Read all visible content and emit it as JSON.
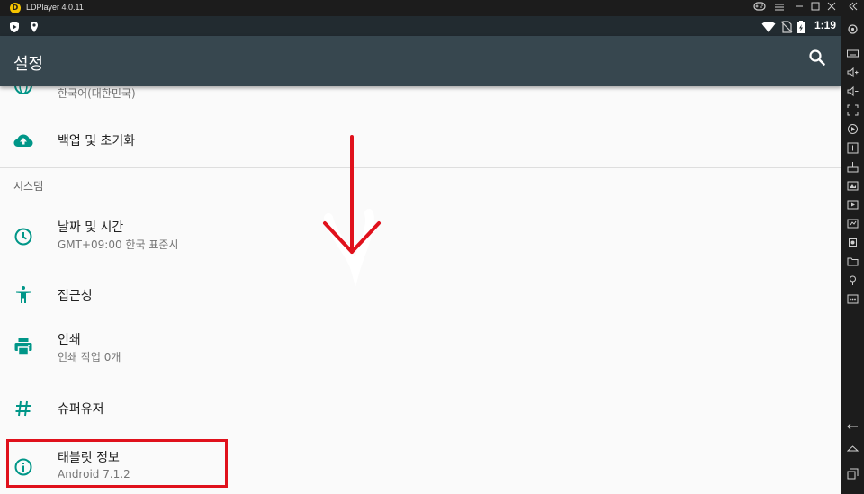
{
  "emulator": {
    "title": "LDPlayer 4.0.11",
    "logo_glyph": "D",
    "controls": [
      "gamepad-icon",
      "menu-icon",
      "minimize-icon",
      "maximize-icon",
      "close-icon",
      "collapse-icon"
    ]
  },
  "statusbar": {
    "time": "1:19",
    "left_icons": [
      "shield-play-icon",
      "location-pin-icon"
    ],
    "right_icons": [
      "wifi-icon",
      "no-sim-icon",
      "battery-charging-icon"
    ]
  },
  "appbar": {
    "title": "설정",
    "action_icon": "search-icon"
  },
  "settings": {
    "partial_row": {
      "subtitle": "한국어(대한민국)",
      "icon": "globe-icon"
    },
    "backup_row": {
      "title": "백업 및 초기화",
      "icon": "cloud-upload-icon"
    },
    "section_system": "시스템",
    "datetime_row": {
      "title": "날짜 및 시간",
      "subtitle": "GMT+09:00 한국 표준시",
      "icon": "clock-icon"
    },
    "accessibility_row": {
      "title": "접근성",
      "icon": "accessibility-icon"
    },
    "printing_row": {
      "title": "인쇄",
      "subtitle": "인쇄 작업 0개",
      "icon": "print-icon"
    },
    "superuser_row": {
      "title": "슈퍼유저",
      "icon": "hash-icon"
    },
    "about_row": {
      "title": "태블릿 정보",
      "subtitle": "Android 7.1.2",
      "icon": "info-icon"
    }
  },
  "annotations": {
    "highlight_color": "#e0111c",
    "arrow_direction": "down"
  },
  "colors": {
    "statusbar": "#222b30",
    "appbar": "#37474f",
    "accent": "#009688",
    "background": "#fafafa"
  },
  "side_toolbar": [
    "keyboard-icon",
    "volume-up-icon",
    "volume-down-icon",
    "fullscreen-icon",
    "record-icon",
    "add-app-icon",
    "install-apk-icon",
    "screenshot-icon",
    "video-icon",
    "sync-icon",
    "operation-recorder-icon",
    "folder-icon",
    "location-icon",
    "more-icon",
    "back-icon",
    "home-icon",
    "recent-apps-icon"
  ]
}
